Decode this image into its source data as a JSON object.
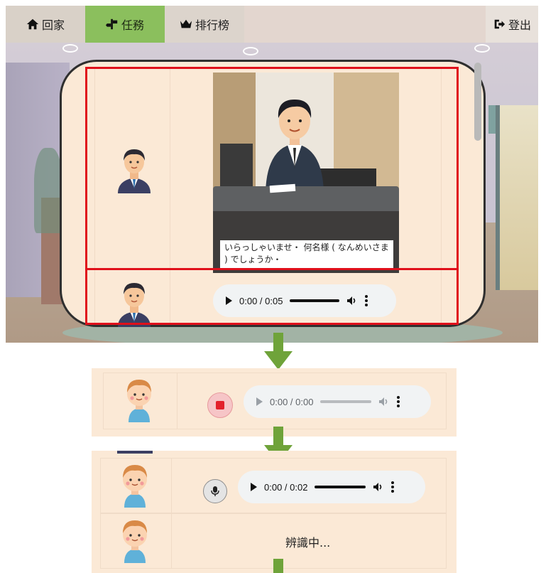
{
  "nav": {
    "home_label": "回家",
    "task_label": "任務",
    "rank_label": "排行榜",
    "logout_label": "登出"
  },
  "dialog": {
    "subtitle": "いらっしゃいませ・ 何名様 ( なんめいさま ) でしょうか・",
    "npc_audio_time": "0:00 / 0:05"
  },
  "step_recording": {
    "audio_time": "0:00 / 0:00"
  },
  "step_recorded": {
    "audio_time": "0:00 / 0:02"
  },
  "step_recognizing": {
    "status": "辨識中..."
  },
  "colors": {
    "highlight_border": "#e0101b",
    "active_tab": "#8bbf5d",
    "arrow": "#6fa33a",
    "panel_bg": "#fbe9d6",
    "record_button": "#e3202b"
  },
  "icons": {
    "home": "home-icon",
    "task": "signpost-icon",
    "rank": "crown-icon",
    "logout": "logout-icon",
    "record": "stop-record-icon",
    "mic": "microphone-icon"
  }
}
